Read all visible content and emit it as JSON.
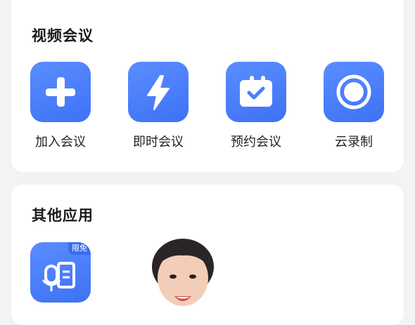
{
  "video_meeting": {
    "title": "视频会议",
    "actions": [
      {
        "label": "加入会议",
        "icon": "plus-icon"
      },
      {
        "label": "即时会议",
        "icon": "lightning-icon"
      },
      {
        "label": "预约会议",
        "icon": "calendar-check-icon"
      },
      {
        "label": "云录制",
        "icon": "record-icon"
      }
    ]
  },
  "other_apps": {
    "title": "其他应用",
    "apps": [
      {
        "badge": "限免",
        "icon": "voice-transcribe-icon"
      }
    ]
  },
  "colors": {
    "tile": "#4a7ffa",
    "badge": "#3a6df0",
    "card": "#ffffff",
    "background": "#f2f3f5"
  }
}
